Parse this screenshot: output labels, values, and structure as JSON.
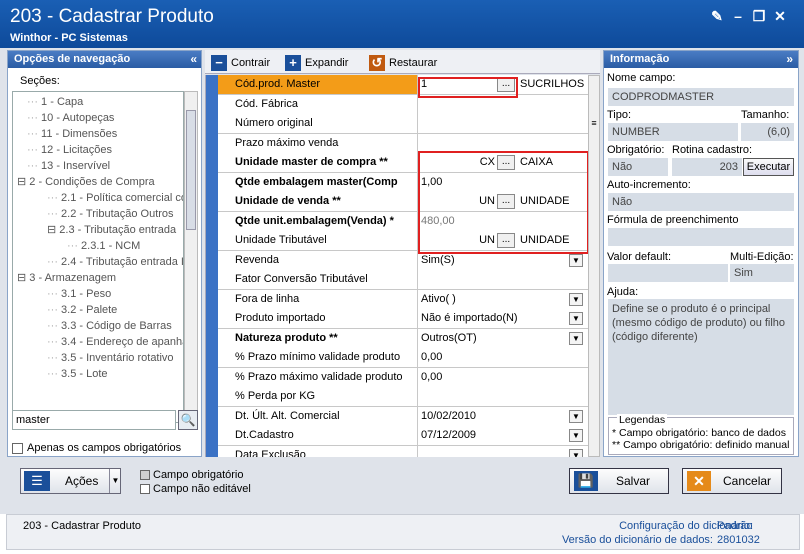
{
  "window": {
    "title": "203 - Cadastrar  Produto",
    "subtitle": "Winthor - PC Sistemas"
  },
  "nav": {
    "header": "Opções de navegação",
    "sections_label": "Seções:",
    "items": [
      {
        "label": "1 - Capa",
        "level": 1
      },
      {
        "label": "10 - Autopeças",
        "level": 1
      },
      {
        "label": "11 - Dimensões",
        "level": 1
      },
      {
        "label": "12 - Licitações",
        "level": 1
      },
      {
        "label": "13 - Inservível",
        "level": 1
      },
      {
        "label": "2 - Condições de Compra",
        "level": 0,
        "toggle": "⊟"
      },
      {
        "label": "2.1 - Política comercial comp",
        "level": 2
      },
      {
        "label": "2.2 - Tributação Outros",
        "level": 2
      },
      {
        "label": "2.3 - Tributação entrada",
        "level": 2,
        "toggle": "⊟"
      },
      {
        "label": "2.3.1 - NCM",
        "level": 3
      },
      {
        "label": "2.4 - Tributação entrada In",
        "level": 2
      },
      {
        "label": "3 - Armazenagem",
        "level": 0,
        "toggle": "⊟"
      },
      {
        "label": "3.1 - Peso",
        "level": 2
      },
      {
        "label": "3.2 - Palete",
        "level": 2
      },
      {
        "label": "3.3 - Código de Barras",
        "level": 2
      },
      {
        "label": "3.4 - Endereço de apanha",
        "level": 2
      },
      {
        "label": "3.5 - Inventário rotativo",
        "level": 2
      },
      {
        "label": "3.5 - Lote",
        "level": 2
      }
    ],
    "search_value": "master",
    "only_required_label": "Apenas os campos obrigatórios"
  },
  "toolbar": {
    "collapse": "Contrair",
    "expand": "Expandir",
    "restore": "Restaurar"
  },
  "grid": {
    "rows": [
      {
        "label": "Cód.prod. Master",
        "value": "1",
        "extra": "SUCRILHOS K",
        "ellipsis": true,
        "bold": false,
        "selected": true
      },
      {
        "label": "Cód. Fábrica",
        "value": ""
      },
      {
        "label": "Número original",
        "value": ""
      },
      {
        "label": "Prazo máximo venda",
        "value": ""
      },
      {
        "label": "Unidade master de compra **",
        "value": "CX",
        "extra": "CAIXA",
        "ellipsis": true,
        "bold": true,
        "align": "right"
      },
      {
        "label": "Qtde embalagem master(Comp",
        "value": "1,00",
        "bold": true
      },
      {
        "label": "Unidade de venda **",
        "value": "UN",
        "extra": "UNIDADE",
        "ellipsis": true,
        "bold": true,
        "align": "right"
      },
      {
        "label": "Qtde unit.embalagem(Venda) *",
        "value": "480,00",
        "bold": true,
        "gray": true
      },
      {
        "label": "Unidade Tributável",
        "value": "UN",
        "extra": "UNIDADE",
        "ellipsis": true,
        "align": "right"
      },
      {
        "label": "Revenda",
        "value": "Sim(S)",
        "dropdown": true
      },
      {
        "label": "Fator Conversão Tributável",
        "value": ""
      },
      {
        "label": "Fora de linha",
        "value": "Ativo(  )",
        "dropdown": true
      },
      {
        "label": "Produto importado",
        "value": "Não é importado(N)",
        "dropdown": true
      },
      {
        "label": "Natureza produto **",
        "value": "Outros(OT)",
        "dropdown": true,
        "bold": true
      },
      {
        "label": "% Prazo mínimo validade produto",
        "value": "0,00"
      },
      {
        "label": "% Prazo máximo validade produto",
        "value": "0,00"
      },
      {
        "label": "% Perda por KG",
        "value": ""
      },
      {
        "label": "Dt. Últ. Alt. Comercial",
        "value": "10/02/2010",
        "dropdown": true
      },
      {
        "label": "Dt.Cadastro",
        "value": "07/12/2009",
        "dropdown": true
      },
      {
        "label": "Data Exclusão",
        "value": "",
        "dropdown": true
      }
    ]
  },
  "info": {
    "header": "Informação",
    "field_name_label": "Nome campo:",
    "field_name": "CODPRODMASTER",
    "type_label": "Tipo:",
    "size_label": "Tamanho:",
    "type": "NUMBER",
    "size": "(6,0)",
    "required_label": "Obrigatório:",
    "routine_label": "Rotina cadastro:",
    "required": "Não",
    "routine": "203",
    "execute_label": "Executar",
    "auto_inc_label": "Auto-incremento:",
    "auto_inc": "Não",
    "formula_label": "Fórmula de preenchimento",
    "default_label": "Valor default:",
    "multi_label": "Multi-Edição:",
    "multi": "Sim",
    "help_label": "Ajuda:",
    "help": "Define se o produto é o principal (mesmo código de produto) ou filho (código diferente)",
    "legend_title": "Legendas",
    "legend1": "* Campo obrigatório: banco de dados",
    "legend2": "** Campo obrigatório: definido manual"
  },
  "actions": {
    "acoes": "Ações",
    "legend_required": "Campo obrigatório",
    "legend_readonly": "Campo não editável",
    "save": "Salvar",
    "cancel": "Cancelar"
  },
  "status": {
    "left": "203 - Cadastrar  Produto",
    "dict_config_label": "Configuração do dicionário:",
    "dict_config": "Padrão",
    "dict_version_label": "Versão do dicionário de dados:",
    "dict_version": "2801032"
  },
  "colors": {
    "accent": "#3b72c5",
    "selected": "#f39c18",
    "highlight": "#e02020"
  }
}
